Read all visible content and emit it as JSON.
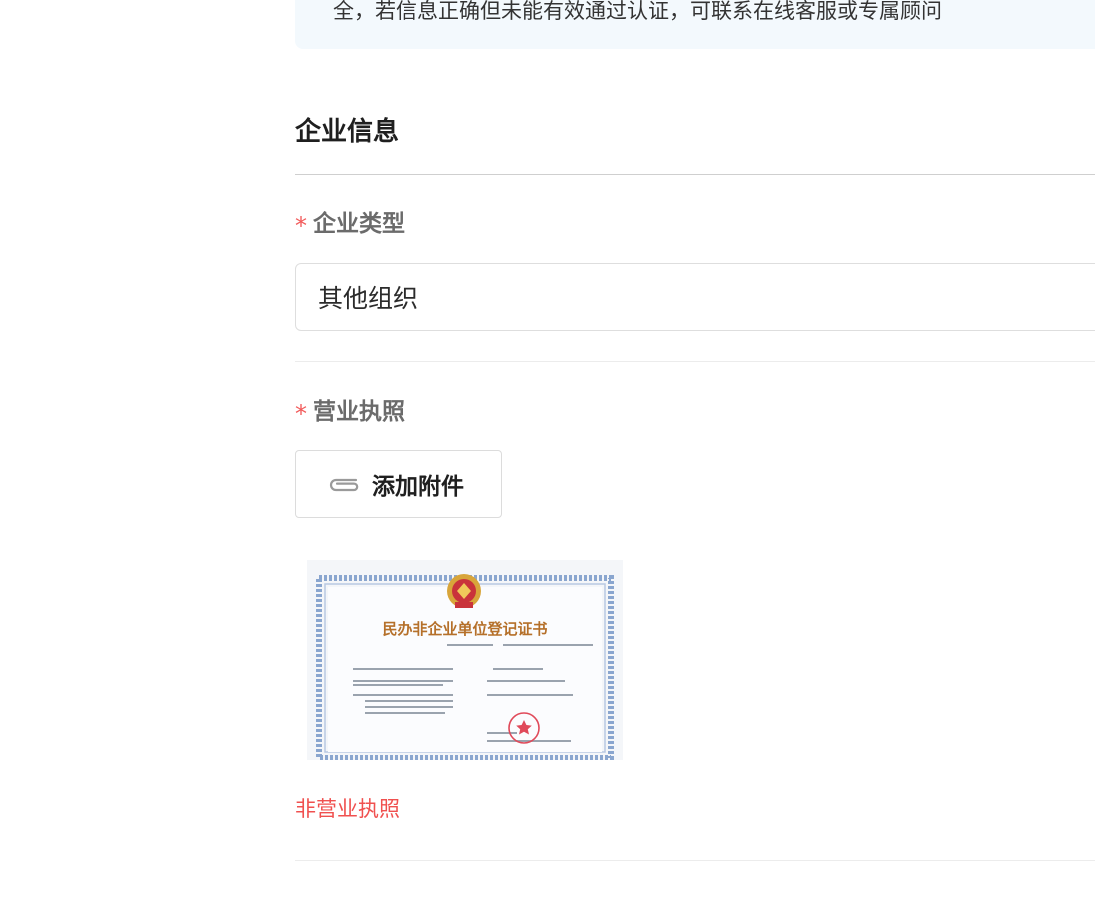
{
  "notice": {
    "text": "全，若信息正确但未能有效通过认证，可联系在线客服或专属顾问"
  },
  "section": {
    "title": "企业信息"
  },
  "fields": {
    "enterprise_type": {
      "required_mark": "*",
      "label": "企业类型",
      "value": "其他组织"
    },
    "business_license": {
      "required_mark": "*",
      "label": "营业执照",
      "attach_button_label": "添加附件",
      "attach_icon": "paperclip-icon",
      "certificate": {
        "title": "民办非企业单位登记证书",
        "stamp_icon": "official-seal-icon",
        "emblem_icon": "national-emblem-icon"
      },
      "error_text": "非营业执照"
    }
  },
  "colors": {
    "required": "#f25b5b",
    "error": "#f0504f",
    "notice_bg": "#f3f9fd",
    "certificate_border": "#8aa6cf",
    "certificate_title": "#b5702a"
  }
}
